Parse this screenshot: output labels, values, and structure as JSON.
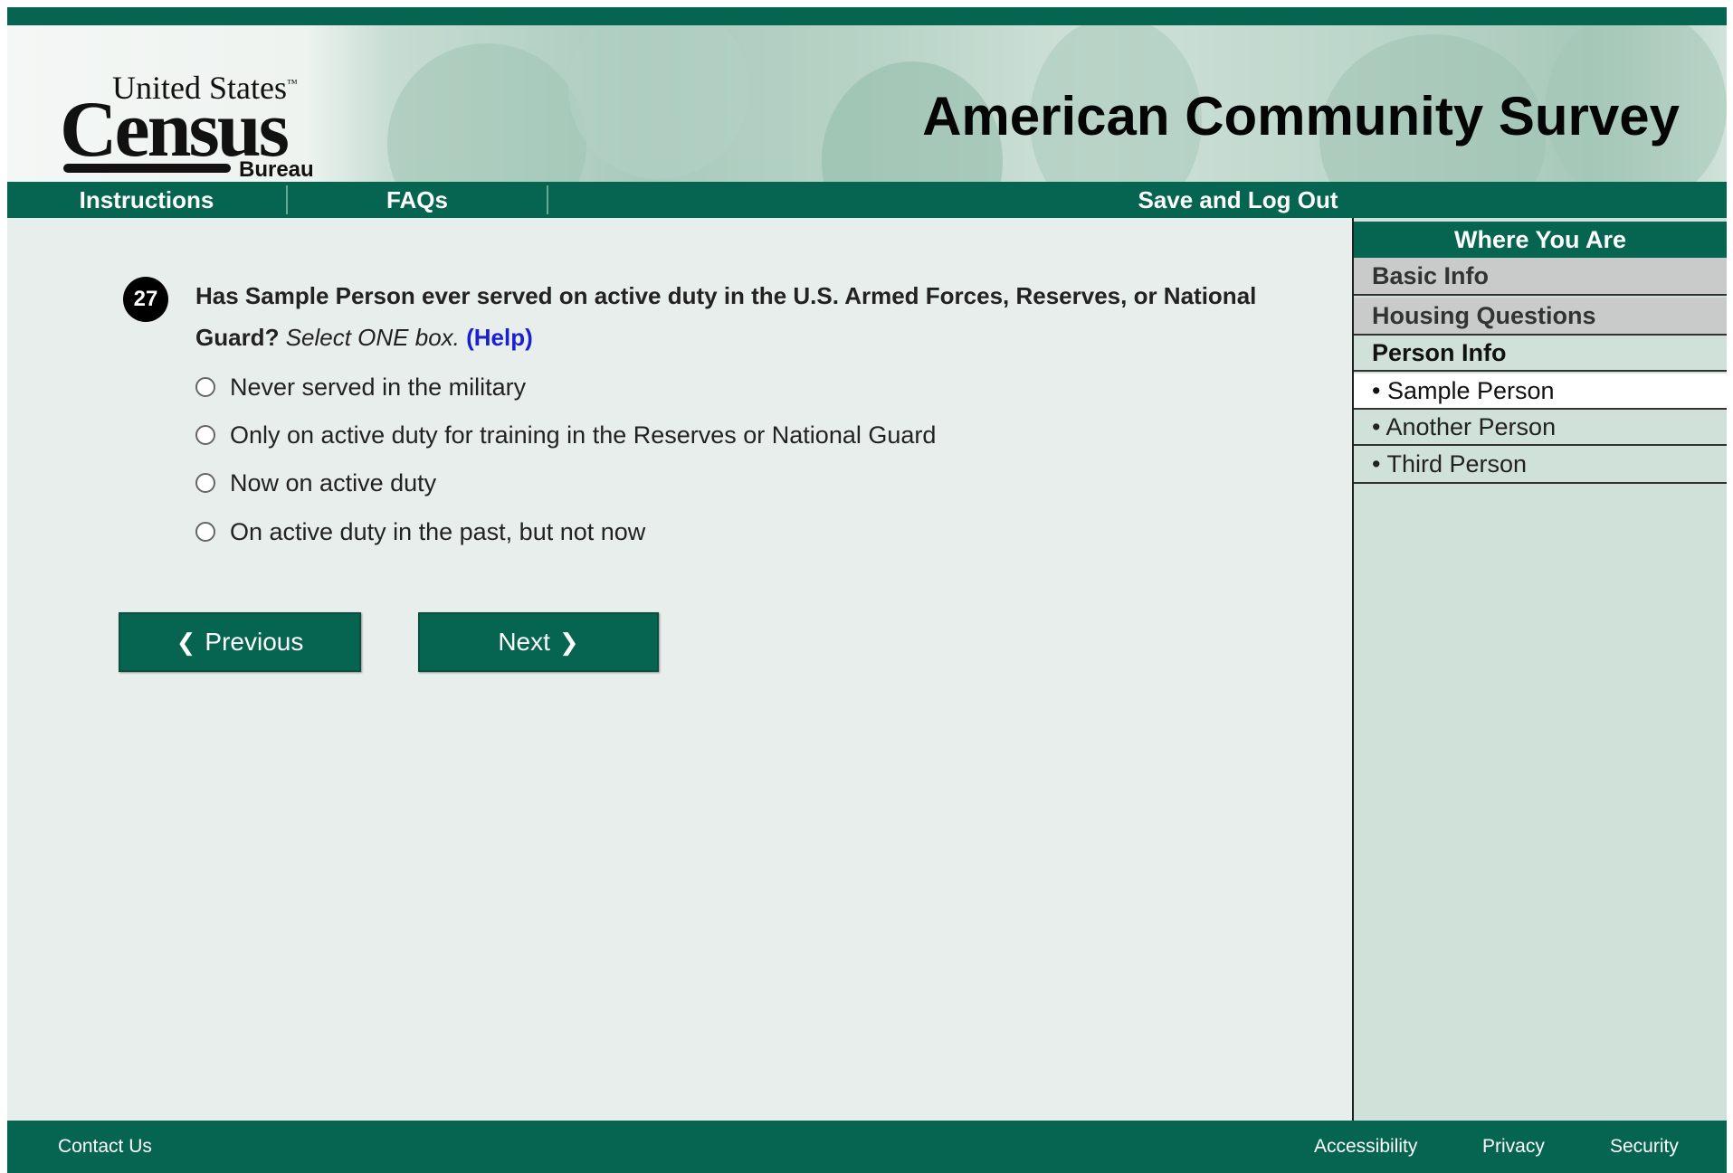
{
  "header": {
    "logo": {
      "line1": "United States",
      "tm": "™",
      "main": "Census",
      "sub": "Bureau"
    },
    "title": "American Community Survey"
  },
  "nav": {
    "instructions": "Instructions",
    "faqs": "FAQs",
    "save_logout": "Save and Log Out"
  },
  "question": {
    "number": "27",
    "text": "Has Sample Person ever served on active duty in the U.S. Armed Forces, Reserves, or National Guard?",
    "instruction": "Select ONE box.",
    "help": "(Help)",
    "options": [
      "Never served in the military",
      "Only on active duty for training in the Reserves or National Guard",
      "Now on active duty",
      "On active duty in the past, but not now"
    ]
  },
  "buttons": {
    "previous": "Previous",
    "next": "Next"
  },
  "sidebar": {
    "title": "Where You Are",
    "sections": [
      "Basic Info",
      "Housing Questions",
      "Person Info"
    ],
    "persons": [
      "• Sample Person",
      "• Another Person",
      "• Third Person"
    ]
  },
  "footer": {
    "contact": "Contact Us",
    "accessibility": "Accessibility",
    "privacy": "Privacy",
    "security": "Security"
  },
  "colors": {
    "brand_green": "#056551",
    "sidebar_bg": "#d0e1d9",
    "page_bg": "#e8eeeb",
    "help_link": "#1a1fd1"
  }
}
